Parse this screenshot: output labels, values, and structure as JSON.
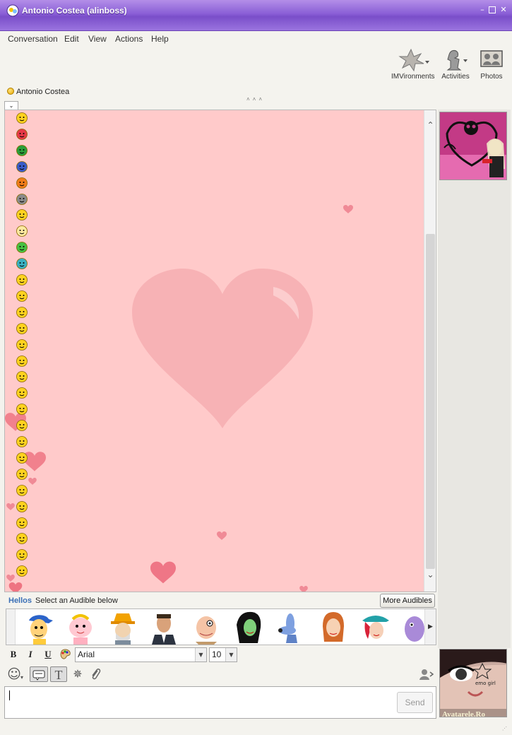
{
  "window": {
    "title": "Antonio Costea (alinboss)"
  },
  "menu": [
    "Conversation",
    "Edit",
    "View",
    "Actions",
    "Help"
  ],
  "toolbar": {
    "imvironments": "IMVironments",
    "activities": "Activities",
    "photos": "Photos"
  },
  "contact": {
    "name": "Antonio Costea",
    "status_color": "#f2c000"
  },
  "conversation": {
    "background_color": "#ffcaca",
    "heart_color": "#f2a5a8",
    "emoticons": [
      "angel-icon",
      "rose-icon",
      "four-leaf-clover-icon",
      "us-flag-icon",
      "pumpkin-icon",
      "coffee-icon",
      "idea-icon",
      "skull-icon",
      "alien-icon",
      "yin-yang-icon",
      "sleepy-icon",
      "thinking-icon",
      "nerd-icon",
      "whistling-icon",
      "confused-icon",
      "clapping-icon",
      "pointing-icon",
      "shh-icon",
      "waving-icon",
      "love-struck-icon",
      "hiding-icon",
      "applause-icon",
      "laughing-icon",
      "star-icon",
      "hair-boy-icon",
      "hair-girl-icon",
      "red-hair-icon",
      "ball-icon",
      "bee-icon"
    ]
  },
  "audibles": {
    "heading": "Hellos",
    "hint": "Select an Audible below",
    "more_label": "More Audibles"
  },
  "format": {
    "bold": "B",
    "italic": "I",
    "underline": "U",
    "font": "Arial",
    "size": "10"
  },
  "input": {
    "value": "",
    "send_label": "Send"
  },
  "avatars": {
    "my_pic_caption": "Avatarele.Ro",
    "my_pic_text": "emo girl"
  }
}
